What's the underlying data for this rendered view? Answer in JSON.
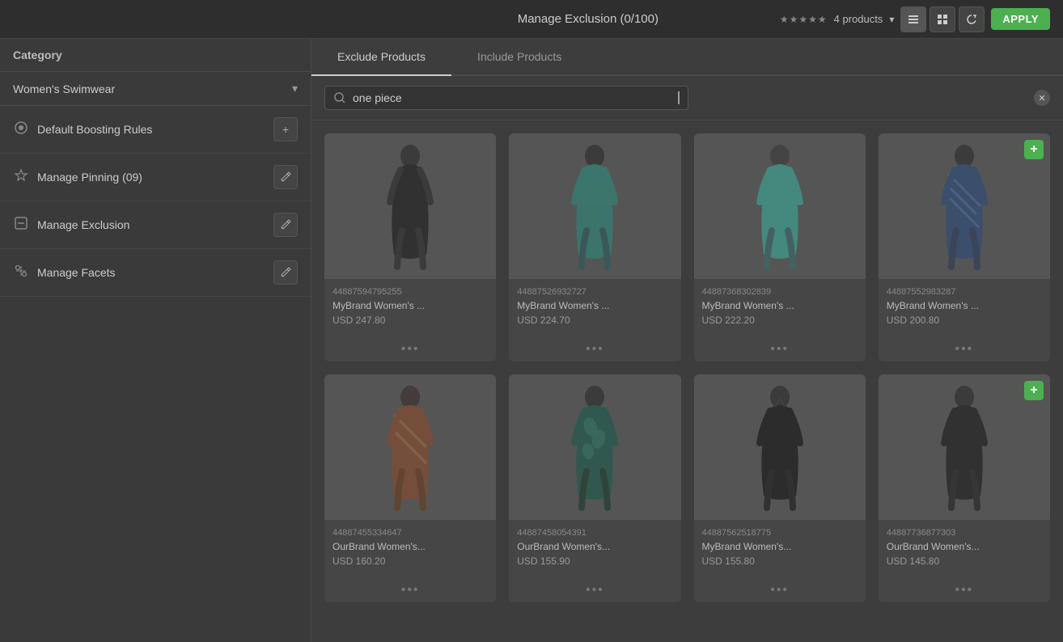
{
  "topbar": {
    "title": "Manage Exclusion (0/100)",
    "stars": "★★★★★",
    "products_count": "4 products",
    "apply_label": "APPLY"
  },
  "sidebar": {
    "header": "Category",
    "category": "Women's Swimwear",
    "items": [
      {
        "id": "default-boosting",
        "icon": "⊙",
        "label": "Default Boosting Rules",
        "action": "+"
      },
      {
        "id": "manage-pinning",
        "icon": "☍",
        "label": "Manage Pinning (09)",
        "action": "edit"
      },
      {
        "id": "manage-exclusion",
        "icon": "⊟",
        "label": "Manage Exclusion",
        "action": "edit"
      },
      {
        "id": "manage-facets",
        "icon": "⚙",
        "label": "Manage Facets",
        "action": "edit"
      }
    ]
  },
  "tabs": [
    {
      "label": "Exclude Products",
      "active": true
    },
    {
      "label": "Include Products",
      "active": false
    }
  ],
  "search": {
    "placeholder": "one piece",
    "value": "one piece"
  },
  "products": [
    {
      "id": "44887594795255",
      "name": "MyBrand Women's ...",
      "price": "USD 247.80",
      "color": "black",
      "badge": false,
      "row": 1
    },
    {
      "id": "44887526932727",
      "name": "MyBrand Women's ...",
      "price": "USD 224.70",
      "color": "teal",
      "badge": false,
      "row": 1
    },
    {
      "id": "44887368302839",
      "name": "MyBrand Women's ...",
      "price": "USD 222.20",
      "color": "teal-light",
      "badge": false,
      "row": 1
    },
    {
      "id": "44887552983287",
      "name": "MyBrand Women's ...",
      "price": "USD 200.80",
      "color": "blue-pattern",
      "badge": true,
      "row": 1
    },
    {
      "id": "44887455334647",
      "name": "OurBrand Women's...",
      "price": "USD 160.20",
      "color": "orange",
      "badge": false,
      "row": 2
    },
    {
      "id": "44887458054391",
      "name": "OurBrand Women's...",
      "price": "USD 155.90",
      "color": "dark-teal",
      "badge": false,
      "row": 2
    },
    {
      "id": "44887562518775",
      "name": "MyBrand Women's...",
      "price": "USD 155.80",
      "color": "black2",
      "badge": false,
      "row": 2
    },
    {
      "id": "44887736877303",
      "name": "OurBrand Women's...",
      "price": "USD 145.80",
      "color": "dark2",
      "badge": true,
      "row": 2
    }
  ],
  "icons": {
    "search": "🔍",
    "clear": "✕",
    "grid": "⊞",
    "list": "≡",
    "refresh": "↺",
    "plus": "+",
    "edit": "✎",
    "chevron": "▾"
  }
}
